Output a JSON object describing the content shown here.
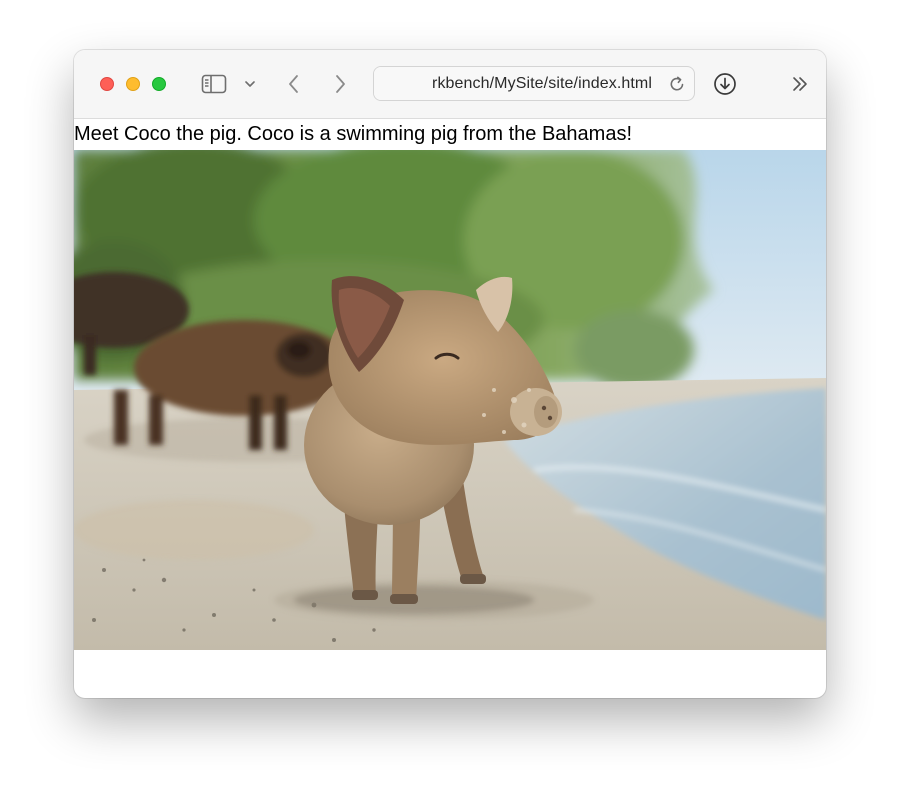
{
  "browser": {
    "address": "rkbench/MySite/site/index.html",
    "icons": {
      "sidebar": "sidebar-icon",
      "tab_overview_chevron": "chevron-down-icon",
      "back": "chevron-left-icon",
      "forward": "chevron-right-icon",
      "reload": "reload-icon",
      "downloads": "download-icon",
      "more": "double-chevron-right-icon"
    },
    "colors": {
      "close": "#fe5f57",
      "minimize": "#febc2e",
      "maximize": "#28c840"
    }
  },
  "page": {
    "caption": "Meet Coco the pig. Coco is a swimming pig from the Bahamas!"
  }
}
